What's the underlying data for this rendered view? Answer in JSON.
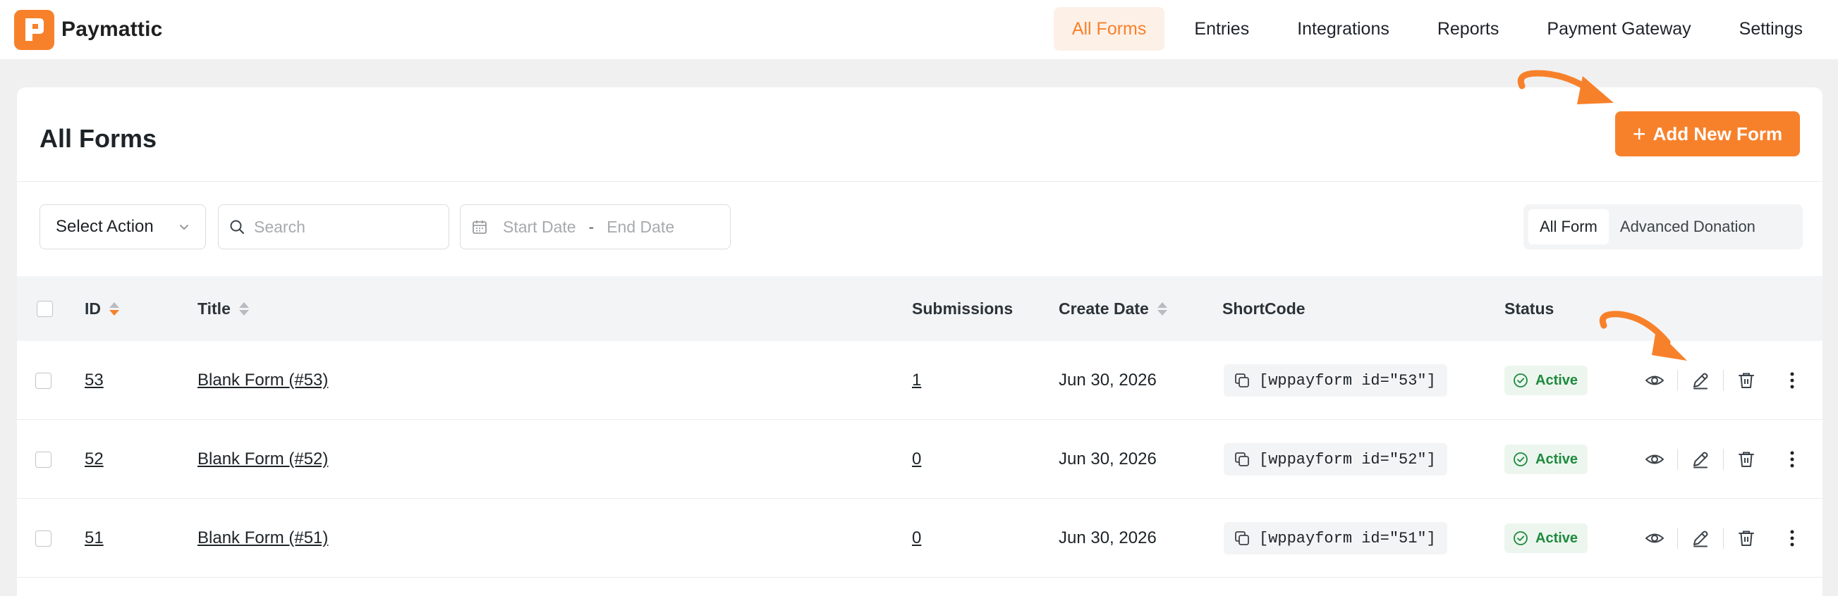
{
  "app": {
    "name": "Paymattic"
  },
  "nav": {
    "items": [
      {
        "label": "All Forms",
        "active": true
      },
      {
        "label": "Entries",
        "active": false
      },
      {
        "label": "Integrations",
        "active": false
      },
      {
        "label": "Reports",
        "active": false
      },
      {
        "label": "Payment Gateway",
        "active": false
      },
      {
        "label": "Settings",
        "active": false
      }
    ]
  },
  "page": {
    "title": "All Forms",
    "add_button_label": "Add New Form"
  },
  "filters": {
    "select_action_label": "Select Action",
    "search_placeholder": "Search",
    "start_date_placeholder": "Start Date",
    "date_separator": "-",
    "end_date_placeholder": "End Date",
    "segments": [
      {
        "label": "All Form",
        "active": true
      },
      {
        "label": "Advanced Donation",
        "active": false
      }
    ]
  },
  "table": {
    "columns": {
      "id": "ID",
      "title": "Title",
      "submissions": "Submissions",
      "create_date": "Create Date",
      "shortcode": "ShortCode",
      "status": "Status"
    },
    "rows": [
      {
        "id": "53",
        "title": "Blank Form (#53)",
        "submissions": "1",
        "create_date": "Jun 30, 2026",
        "shortcode": "[wppayform id=\"53\"]",
        "status": "Active"
      },
      {
        "id": "52",
        "title": "Blank Form (#52)",
        "submissions": "0",
        "create_date": "Jun 30, 2026",
        "shortcode": "[wppayform id=\"52\"]",
        "status": "Active"
      },
      {
        "id": "51",
        "title": "Blank Form (#51)",
        "submissions": "0",
        "create_date": "Jun 30, 2026",
        "shortcode": "[wppayform id=\"51\"]",
        "status": "Active"
      }
    ]
  },
  "colors": {
    "accent": "#f7812b",
    "success": "#1e8a3e",
    "success_bg": "#ecf6ee"
  },
  "icons": [
    "paymattic-logo-icon",
    "chevron-down-icon",
    "search-icon",
    "calendar-icon",
    "sort-icon",
    "copy-icon",
    "check-circle-icon",
    "eye-icon",
    "edit-icon",
    "trash-icon",
    "more-vertical-icon",
    "arrow-annotation"
  ]
}
